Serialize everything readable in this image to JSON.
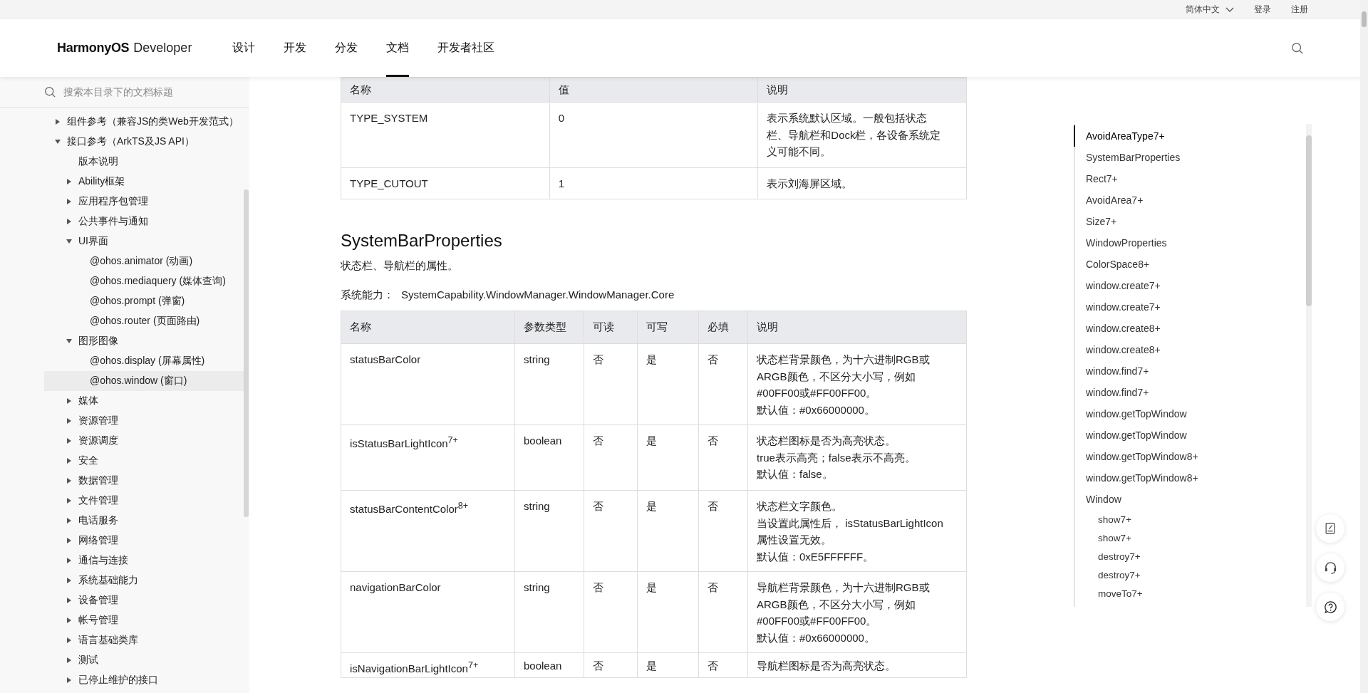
{
  "top_bar": {
    "language": "简体中文",
    "links": [
      "登录",
      "注册"
    ]
  },
  "header": {
    "logo_brand": "HarmonyOS",
    "logo_suffix": "Developer",
    "nav": [
      {
        "label": "设计",
        "selected": false
      },
      {
        "label": "开发",
        "selected": false
      },
      {
        "label": "分发",
        "selected": false
      },
      {
        "label": "文档",
        "selected": true
      },
      {
        "label": "开发者社区",
        "selected": false
      }
    ]
  },
  "sidebar": {
    "search": {
      "placeholder": "搜索本目录下的文档标题"
    },
    "tree": [
      {
        "label": "组件参考（兼容JS的类Web开发范式）",
        "expanded": false,
        "selected": false
      },
      {
        "label": "接口参考（ArkTS及JS API）",
        "expanded": true,
        "selected": false,
        "children": [
          {
            "label": "版本说明",
            "selected": false
          },
          {
            "label": "Ability框架",
            "expanded": false,
            "selected": false
          },
          {
            "label": "应用程序包管理",
            "expanded": false,
            "selected": false
          },
          {
            "label": "公共事件与通知",
            "expanded": false,
            "selected": false
          },
          {
            "label": "UI界面",
            "expanded": true,
            "selected": false,
            "children": [
              {
                "label": "@ohos.animator (动画)",
                "selected": false
              },
              {
                "label": "@ohos.mediaquery (媒体查询)",
                "selected": false
              },
              {
                "label": "@ohos.prompt (弹窗)",
                "selected": false
              },
              {
                "label": "@ohos.router (页面路由)",
                "selected": false
              }
            ]
          },
          {
            "label": "图形图像",
            "expanded": true,
            "selected": false,
            "children": [
              {
                "label": "@ohos.display (屏幕属性)",
                "selected": false
              },
              {
                "label": "@ohos.window (窗口)",
                "selected": true
              }
            ]
          },
          {
            "label": "媒体",
            "expanded": false,
            "selected": false
          },
          {
            "label": "资源管理",
            "expanded": false,
            "selected": false
          },
          {
            "label": "资源调度",
            "expanded": false,
            "selected": false
          },
          {
            "label": "安全",
            "expanded": false,
            "selected": false
          },
          {
            "label": "数据管理",
            "expanded": false,
            "selected": false
          },
          {
            "label": "文件管理",
            "expanded": false,
            "selected": false
          },
          {
            "label": "电话服务",
            "expanded": false,
            "selected": false
          },
          {
            "label": "网络管理",
            "expanded": false,
            "selected": false
          },
          {
            "label": "通信与连接",
            "expanded": false,
            "selected": false
          },
          {
            "label": "系统基础能力",
            "expanded": false,
            "selected": false
          },
          {
            "label": "设备管理",
            "expanded": false,
            "selected": false
          },
          {
            "label": "帐号管理",
            "expanded": false,
            "selected": false
          },
          {
            "label": "语言基础类库",
            "expanded": false,
            "selected": false
          },
          {
            "label": "测试",
            "expanded": false,
            "selected": false
          },
          {
            "label": "已停止维护的接口",
            "expanded": false,
            "selected": false
          }
        ]
      }
    ]
  },
  "content": {
    "area_type_table": {
      "columns": [
        "名称",
        "值",
        "说明"
      ],
      "rows": [
        [
          [
            "TYPE_SYSTEM"
          ],
          [
            "0"
          ],
          [
            "表示系统默认区域。一般包括状态",
            "栏、导航栏和Dock栏，各设备系统定",
            "义可能不同。"
          ]
        ],
        [
          [
            "TYPE_CUTOUT"
          ],
          [
            "1"
          ],
          [
            "表示刘海屏区域。"
          ]
        ]
      ]
    },
    "section": {
      "title": "SystemBarProperties",
      "description": "状态栏、导航栏的属性。",
      "capability_label": "系统能力：",
      "capability_value": "SystemCapability.WindowManager.WindowManager.Core"
    },
    "properties_table": {
      "columns": [
        "名称",
        "参数类型",
        "可读",
        "可写",
        "必填",
        "说明"
      ],
      "rows": [
        [
          [
            "statusBarColor"
          ],
          [
            "string"
          ],
          [
            "否"
          ],
          [
            "是"
          ],
          [
            "否"
          ],
          [
            "状态栏背景颜色，为十六进制RGB或",
            "ARGB颜色，不区分大小写，例如",
            "#00FF00或#FF00FF00。",
            "默认值：#0x66000000。"
          ]
        ],
        [
          [
            "isStatusBarLightIcon$^{7+}$"
          ],
          [
            "boolean"
          ],
          [
            "否"
          ],
          [
            "是"
          ],
          [
            "否"
          ],
          [
            "状态栏图标是否为高亮状态。",
            "true表示高亮；false表示不高亮。",
            "默认值：false。"
          ]
        ],
        [
          [
            "statusBarContentColor$^{8+}$"
          ],
          [
            "string"
          ],
          [
            "否"
          ],
          [
            "是"
          ],
          [
            "否"
          ],
          [
            "状态栏文字颜色。",
            "当设置此属性后， isStatusBarLightIcon",
            "属性设置无效。",
            "默认值：0xE5FFFFFF。"
          ]
        ],
        [
          [
            "navigationBarColor"
          ],
          [
            "string"
          ],
          [
            "否"
          ],
          [
            "是"
          ],
          [
            "否"
          ],
          [
            "导航栏背景颜色，为十六进制RGB或",
            "ARGB颜色，不区分大小写，例如",
            "#00FF00或#FF00FF00。",
            "默认值：#0x66000000。"
          ]
        ],
        [
          [
            "isNavigationBarLightIcon$^{7+}$"
          ],
          [
            "boolean"
          ],
          [
            "否"
          ],
          [
            "是"
          ],
          [
            "否"
          ],
          [
            "导航栏图标是否为高亮状态。"
          ]
        ]
      ]
    }
  },
  "toc": [
    {
      "label": "AvoidAreaType7+",
      "selected": true
    },
    {
      "label": "SystemBarProperties",
      "selected": false
    },
    {
      "label": "Rect7+",
      "selected": false
    },
    {
      "label": "AvoidArea7+",
      "selected": false
    },
    {
      "label": "Size7+",
      "selected": false
    },
    {
      "label": "WindowProperties",
      "selected": false
    },
    {
      "label": "ColorSpace8+",
      "selected": false
    },
    {
      "label": "window.create7+",
      "selected": false
    },
    {
      "label": "window.create7+",
      "selected": false
    },
    {
      "label": "window.create8+",
      "selected": false
    },
    {
      "label": "window.create8+",
      "selected": false
    },
    {
      "label": "window.find7+",
      "selected": false
    },
    {
      "label": "window.find7+",
      "selected": false
    },
    {
      "label": "window.getTopWindow",
      "selected": false
    },
    {
      "label": "window.getTopWindow",
      "selected": false
    },
    {
      "label": "window.getTopWindow8+",
      "selected": false
    },
    {
      "label": "window.getTopWindow8+",
      "selected": false
    },
    {
      "label": "Window",
      "selected": false,
      "children": [
        {
          "label": "show7+",
          "selected": false
        },
        {
          "label": "show7+",
          "selected": false
        },
        {
          "label": "destroy7+",
          "selected": false
        },
        {
          "label": "destroy7+",
          "selected": false
        },
        {
          "label": "moveTo7+",
          "selected": false
        }
      ]
    }
  ]
}
